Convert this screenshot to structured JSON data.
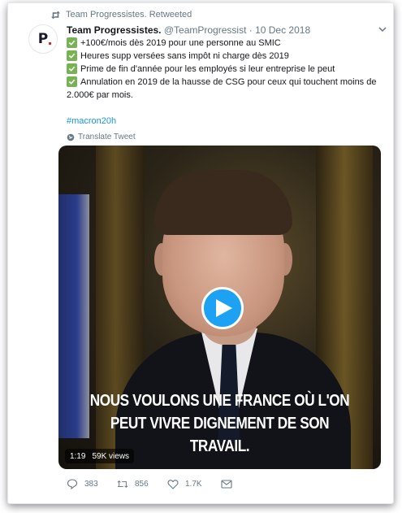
{
  "retweet_line": {
    "text": "Team Progressistes. Retweeted",
    "icon": "retweet-icon"
  },
  "author": {
    "name": "Team Progressistes.",
    "handle": "@TeamProgressist",
    "date": "· 10 Dec 2018",
    "avatar_text": "P"
  },
  "tweet": {
    "lines": [
      "+100€/mois dès 2019 pour une personne au SMIC",
      "Heures supp versées sans impôt ni charge dès 2019",
      "Prime de fin d'année pour les employés si leur entreprise le peut",
      "Annulation en 2019 de la hausse de CSG pour ceux qui touchent moins de"
    ],
    "continuation": "2.000€ par mois.",
    "hashtag": "#macron20h",
    "translate": "Translate Tweet"
  },
  "video": {
    "caption_line1": "NOUS VOULONS UNE FRANCE OÙ L'ON",
    "caption_line2": "PEUT VIVRE DIGNEMENT DE SON TRAVAIL.",
    "duration": "1:19",
    "views": "59K views"
  },
  "actions": {
    "replies": "383",
    "retweets": "856",
    "likes": "1.7K"
  },
  "colors": {
    "accent": "#1da1f2",
    "check": "#77b255",
    "muted": "#657786",
    "link": "#1b95e0"
  }
}
